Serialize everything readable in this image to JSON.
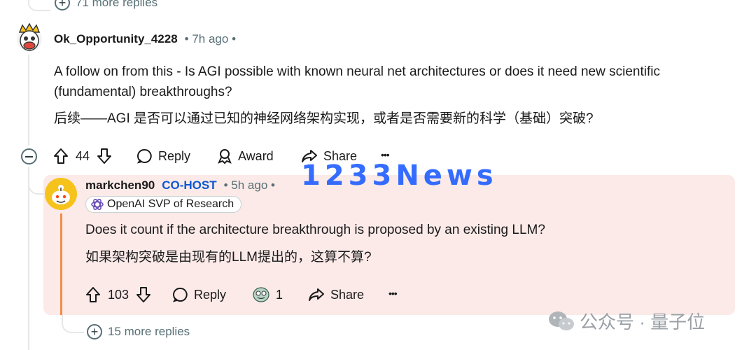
{
  "top": {
    "more_replies": "71 more replies"
  },
  "comment1": {
    "username": "Ok_Opportunity_4228",
    "time": "• 7h ago •",
    "text_en_line1": "A follow on from this - Is AGI possible with known neural net architectures or does it need new scientific",
    "text_en_line2": "(fundamental) breakthroughs?",
    "text_zh": "后续——AGI 是否可以通过已知的神经网络架构实现，或者是否需要新的科学（基础）突破?",
    "votes": "44",
    "reply_label": "Reply",
    "award_label": "Award",
    "share_label": "Share",
    "more_label": "•••"
  },
  "comment2": {
    "username": "markchen90",
    "role": "CO-HOST",
    "time": "• 5h ago •",
    "flair": "OpenAI SVP of Research",
    "text_en": "Does it count if the architecture breakthrough is proposed by an existing LLM?",
    "text_zh": "如果架构突破是由现有的LLM提出的，这算不算?",
    "votes": "103",
    "reply_label": "Reply",
    "award_count": "1",
    "share_label": "Share",
    "more_label": "•••"
  },
  "bottom": {
    "more_replies": "15 more replies"
  },
  "watermark": {
    "text": "1233News"
  },
  "wechat": {
    "text": "公众号 · 量子位"
  },
  "colors": {
    "highlight_bg": "#fbeae8",
    "cohost": "#0b57d0",
    "watermark": "#1f5eff"
  }
}
